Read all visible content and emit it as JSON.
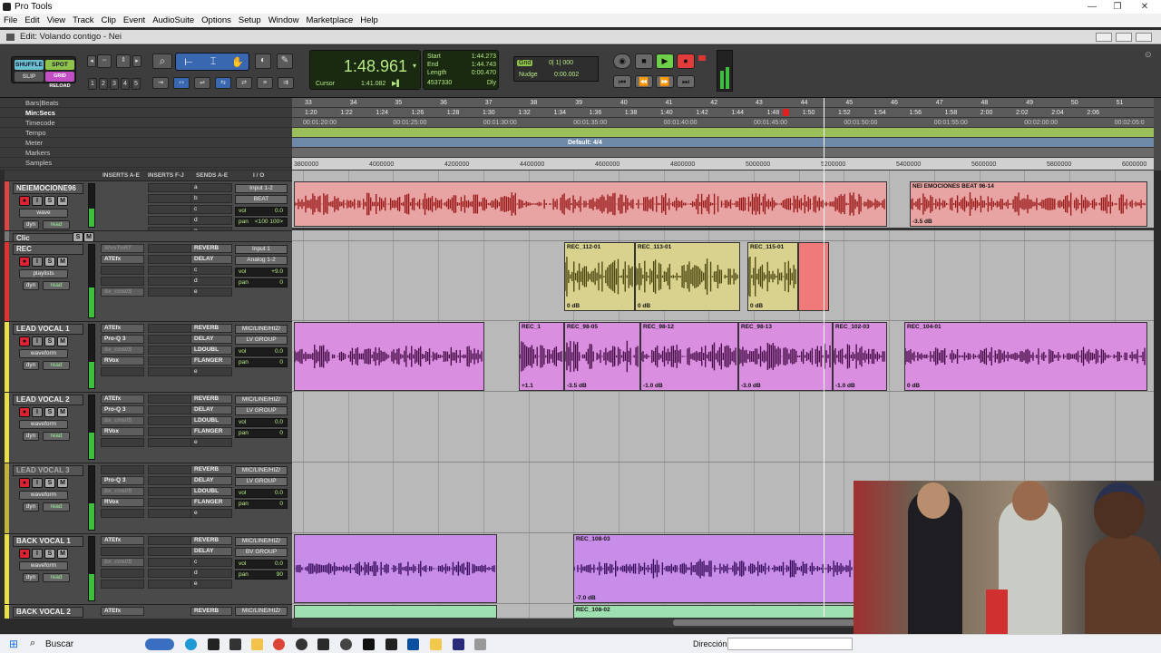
{
  "window": {
    "title": "Pro Tools",
    "edit_title": "Edit: Volando contigo - Nei"
  },
  "menu": [
    "File",
    "Edit",
    "View",
    "Track",
    "Clip",
    "Event",
    "AudioSuite",
    "Options",
    "Setup",
    "Window",
    "Marketplace",
    "Help"
  ],
  "modes": {
    "shuffle": "SHUFFLE",
    "spot": "SPOT",
    "slip": "SLIP",
    "grid": "GRID",
    "reload": "RELOAD"
  },
  "counter": {
    "main": "1:48.961",
    "cursor_label": "Cursor",
    "cursor_value": "1:41.082",
    "samples": "4537330"
  },
  "selection": {
    "start_label": "Start",
    "start": "1:44.273",
    "end_label": "End",
    "end": "1:44.743",
    "length_label": "Length",
    "length": "0:00.470",
    "dly": "Dly"
  },
  "grid": {
    "grid_label": "Grid",
    "grid_value": "0| 1| 000",
    "nudge_label": "Nudge",
    "nudge_value": "0:00.002"
  },
  "track_numbers": [
    "1",
    "2",
    "3",
    "4",
    "5"
  ],
  "rulers": {
    "labels": [
      "Bars|Beats",
      "Min:Secs",
      "Timecode",
      "Tempo",
      "Meter",
      "Markers",
      "Samples"
    ],
    "bars": [
      "33",
      "34",
      "35",
      "36",
      "37",
      "38",
      "39",
      "40",
      "41",
      "42",
      "43",
      "44",
      "45",
      "46",
      "47",
      "48",
      "49",
      "50",
      "51"
    ],
    "minsecs": [
      "1:20",
      "1:22",
      "1:24",
      "1:26",
      "1:28",
      "1:30",
      "1:32",
      "1:34",
      "1:36",
      "1:38",
      "1:40",
      "1:42",
      "1:44",
      "1:48",
      "1:50",
      "1:52",
      "1:54",
      "1:56",
      "1:58",
      "2:00",
      "2:02",
      "2:04",
      "2:06"
    ],
    "timecode": [
      "00:01:20:00",
      "00:01:25:00",
      "00:01:30:00",
      "00:01:35:00",
      "00:01:40:00",
      "00:01:45:00",
      "00:01:50:00",
      "00:01:55:00",
      "00:02:00:00",
      "00:02:05:0"
    ],
    "meter": "Default: 4/4",
    "samples": [
      "3800000",
      "4000000",
      "4200000",
      "4400000",
      "4600000",
      "4800000",
      "5000000",
      "5200000",
      "5400000",
      "5600000",
      "5800000",
      "6000000"
    ]
  },
  "columns": {
    "inserts_ae": "INSERTS A-E",
    "inserts_fj": "INSERTS F-J",
    "sends": "SENDS A-E",
    "io": "I / O"
  },
  "tracks": [
    {
      "name": "NEIEMOCIONE96",
      "view": "wave",
      "extra": "read",
      "inserts": [],
      "sends": [
        "a",
        "b",
        "c",
        "d",
        "e"
      ],
      "io": [
        "Input 1-2",
        "BEAT"
      ],
      "vol": "vol",
      "vol_value": "0.0",
      "pan": "<100  100>"
    },
    {
      "name": "Clic",
      "view": "",
      "extra": "",
      "inserts": [],
      "sends": [],
      "io": [],
      "vol": "",
      "vol_value": "",
      "pan": ""
    },
    {
      "name": "REC",
      "view": "playlists",
      "extra": "read",
      "inserts": [
        "WvsTnRT",
        "ATEfx",
        "",
        "",
        "bx_cnsl/S"
      ],
      "sends": [
        "REVERB",
        "DELAY",
        "c",
        "d",
        "e"
      ],
      "io": [
        "Input 1",
        "Analog 1-2"
      ],
      "vol": "vol",
      "vol_value": "+9.0",
      "pan": "0"
    },
    {
      "name": "LEAD VOCAL 1",
      "view": "waveform",
      "extra": "read",
      "inserts": [
        "ATEfx",
        "Pro-Q 3",
        "bx_cnsl/S",
        "RVox",
        ""
      ],
      "sends": [
        "REVERB",
        "DELAY",
        "LDOUBL",
        "FLANGER",
        "e"
      ],
      "io": [
        "MIC/LINE/HIZ/",
        "LV GROUP"
      ],
      "vol": "vol",
      "vol_value": "0.0",
      "pan": "0"
    },
    {
      "name": "LEAD VOCAL 2",
      "view": "waveform",
      "extra": "read",
      "inserts": [
        "ATEfx",
        "Pro-Q 3",
        "bx_cnsl/S",
        "RVox",
        ""
      ],
      "sends": [
        "REVERB",
        "DELAY",
        "LDOUBL",
        "FLANGER",
        "e"
      ],
      "io": [
        "MIC/LINE/HIZ/",
        "LV GROUP"
      ],
      "vol": "vol",
      "vol_value": "0.0",
      "pan": "0"
    },
    {
      "name": "LEAD VOCAL 3",
      "view": "waveform",
      "extra": "read",
      "inserts": [
        "",
        "Pro-Q 3",
        "bx_cnsl/S",
        "RVox",
        ""
      ],
      "sends": [
        "REVERB",
        "DELAY",
        "LDOUBL",
        "FLANGER",
        "e"
      ],
      "io": [
        "MIC/LINE/HIZ/",
        "LV GROUP"
      ],
      "vol": "vol",
      "vol_value": "0.0",
      "pan": "0"
    },
    {
      "name": "BACK VOCAL 1",
      "view": "waveform",
      "extra": "read",
      "inserts": [
        "ATEfx",
        "",
        "bx_cnsl/S",
        "",
        ""
      ],
      "sends": [
        "REVERB",
        "DELAY",
        "c",
        "d",
        "e"
      ],
      "io": [
        "MIC/LINE/HIZ/",
        "BV GROUP"
      ],
      "vol": "vol",
      "vol_value": "0.0",
      "pan": "90"
    },
    {
      "name": "BACK VOCAL 2",
      "view": "",
      "extra": "",
      "inserts": [
        "ATEfx"
      ],
      "sends": [
        "REVERB"
      ],
      "io": [
        "MIC/LINE/HIZ/"
      ],
      "vol": "",
      "vol_value": "",
      "pan": ""
    }
  ],
  "clips": {
    "beat1": {
      "name": "",
      "gain": ""
    },
    "beat2": {
      "name": "NEI EMOCIONES BEAT 96-14",
      "gain": "-3.5 dB"
    },
    "rec112": {
      "name": "REC_112-01",
      "gain": "0 dB"
    },
    "rec113": {
      "name": "REC_113-01",
      "gain": "0 dB"
    },
    "rec115": {
      "name": "REC_115-01",
      "gain": "0 dB"
    },
    "lv_a": {
      "name": "",
      "gain": ""
    },
    "lv_rec1": {
      "name": "REC_1",
      "gain": "+1.1"
    },
    "lv_9805": {
      "name": "REC_98-05",
      "gain": "-3.5 dB"
    },
    "lv_9812": {
      "name": "REC_98-12",
      "gain": "-1.0 dB"
    },
    "lv_9813": {
      "name": "REC_98-13",
      "gain": "-3.0 dB"
    },
    "lv_10203": {
      "name": "REC_102-03",
      "gain": "-1.0 dB"
    },
    "lv_10401": {
      "name": "REC_104-01",
      "gain": "0 dB"
    },
    "bv_a": {
      "name": "",
      "gain": ""
    },
    "bv_10803": {
      "name": "REC_108-03",
      "gain": "-7.0 dB"
    },
    "bv2_10802": {
      "name": "REC_108-02",
      "gain": ""
    }
  },
  "taskbar": {
    "search": "Buscar",
    "address_label": "Dirección"
  },
  "colors": {
    "beat": "#e8a3a3",
    "rec": "#d8d28e",
    "rec_last": "#f07a7a",
    "lead": "#d98ee0",
    "back": "#c88de8",
    "back2": "#9fe0b0",
    "meter_green": "#3fbf3f"
  }
}
